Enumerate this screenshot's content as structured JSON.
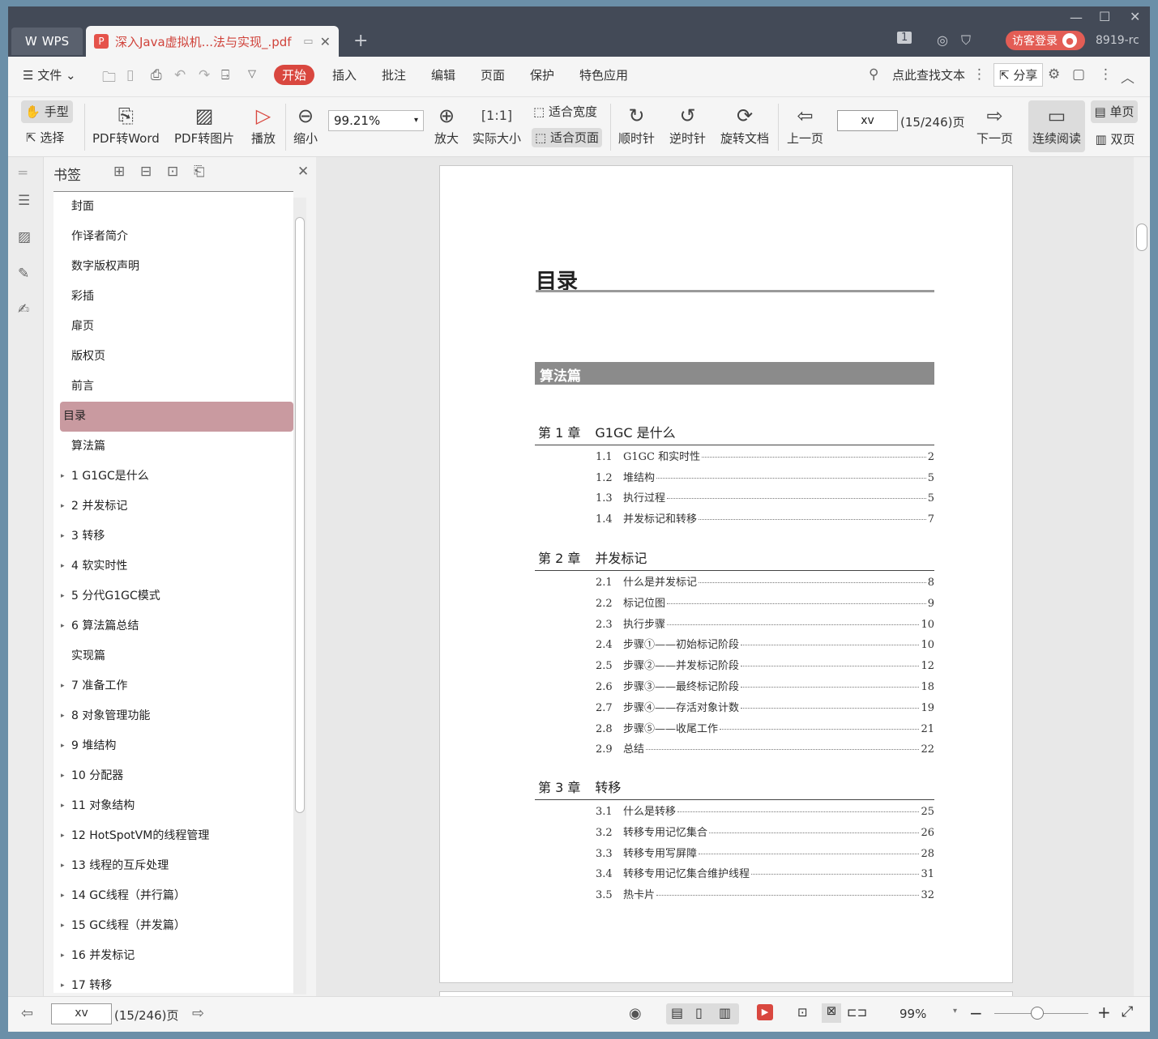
{
  "titlebar": {
    "app_label": "WPS",
    "doc_tab": "深入Java虚拟机...法与实现_.pdf",
    "page_badge": "1",
    "guest_label": "访客登录",
    "user_name": "8919-rc"
  },
  "menubar": {
    "file_label": "文件",
    "tabs": [
      "开始",
      "插入",
      "批注",
      "编辑",
      "页面",
      "保护",
      "特色应用"
    ],
    "search_placeholder": "点此查找文本",
    "share_label": "分享"
  },
  "ribbon": {
    "hand": "手型",
    "select": "选择",
    "pdf_word": "PDF转Word",
    "pdf_img": "PDF转图片",
    "play": "播放",
    "zoom_out": "缩小",
    "zoom_value": "99.21%",
    "zoom_in": "放大",
    "actual": "实际大小",
    "fit_width": "适合宽度",
    "fit_page": "适合页面",
    "cw": "顺时针",
    "ccw": "逆时针",
    "rotate": "旋转文档",
    "prev": "上一页",
    "page_input": "xv",
    "page_count": "(15/246)页",
    "next": "下一页",
    "continuous": "连续阅读",
    "single": "单页",
    "double": "双页"
  },
  "bookmarks": {
    "title": "书签",
    "items": [
      {
        "label": "封面",
        "exp": false
      },
      {
        "label": "作译者简介",
        "exp": false
      },
      {
        "label": "数字版权声明",
        "exp": false
      },
      {
        "label": "彩插",
        "exp": false
      },
      {
        "label": "扉页",
        "exp": false
      },
      {
        "label": "版权页",
        "exp": false
      },
      {
        "label": "前言",
        "exp": false
      },
      {
        "label": "目录",
        "exp": false,
        "selected": true
      },
      {
        "label": "算法篇",
        "exp": false
      },
      {
        "label": "1   G1GC是什么",
        "exp": true
      },
      {
        "label": "2   并发标记",
        "exp": true
      },
      {
        "label": "3   转移",
        "exp": true
      },
      {
        "label": "4   软实时性",
        "exp": true
      },
      {
        "label": "5   分代G1GC模式",
        "exp": true
      },
      {
        "label": "6   算法篇总结",
        "exp": true
      },
      {
        "label": "实现篇",
        "exp": false
      },
      {
        "label": "7   准备工作",
        "exp": true
      },
      {
        "label": "8   对象管理功能",
        "exp": true
      },
      {
        "label": "9   堆结构",
        "exp": true
      },
      {
        "label": "10   分配器",
        "exp": true
      },
      {
        "label": "11   对象结构",
        "exp": true
      },
      {
        "label": "12   HotSpotVM的线程管理",
        "exp": true
      },
      {
        "label": "13   线程的互斥处理",
        "exp": true
      },
      {
        "label": "14   GC线程（并行篇）",
        "exp": true
      },
      {
        "label": "15   GC线程（并发篇）",
        "exp": true
      },
      {
        "label": "16   并发标记",
        "exp": true
      },
      {
        "label": "17   转移",
        "exp": true
      }
    ]
  },
  "doc": {
    "heading": "目录",
    "part": "算法篇",
    "chapters": [
      {
        "num": "第 1 章",
        "title": "G1GC 是什么",
        "secs": [
          [
            "1.1",
            "G1GC 和实时性",
            "2"
          ],
          [
            "1.2",
            "堆结构",
            "5"
          ],
          [
            "1.3",
            "执行过程",
            "5"
          ],
          [
            "1.4",
            "并发标记和转移",
            "7"
          ]
        ]
      },
      {
        "num": "第 2 章",
        "title": "并发标记",
        "secs": [
          [
            "2.1",
            "什么是并发标记",
            "8"
          ],
          [
            "2.2",
            "标记位图",
            "9"
          ],
          [
            "2.3",
            "执行步骤",
            "10"
          ],
          [
            "2.4",
            "步骤①——初始标记阶段",
            "10"
          ],
          [
            "2.5",
            "步骤②——并发标记阶段",
            "12"
          ],
          [
            "2.6",
            "步骤③——最终标记阶段",
            "18"
          ],
          [
            "2.7",
            "步骤④——存活对象计数",
            "19"
          ],
          [
            "2.8",
            "步骤⑤——收尾工作",
            "21"
          ],
          [
            "2.9",
            "总结",
            "22"
          ]
        ]
      },
      {
        "num": "第 3 章",
        "title": "转移",
        "secs": [
          [
            "3.1",
            "什么是转移",
            "25"
          ],
          [
            "3.2",
            "转移专用记忆集合",
            "26"
          ],
          [
            "3.3",
            "转移专用写屏障",
            "28"
          ],
          [
            "3.4",
            "转移专用记忆集合维护线程",
            "31"
          ],
          [
            "3.5",
            "热卡片",
            "32"
          ]
        ]
      }
    ]
  },
  "statusbar": {
    "page_input": "xv",
    "page_count": "(15/246)页",
    "zoom": "99%"
  }
}
